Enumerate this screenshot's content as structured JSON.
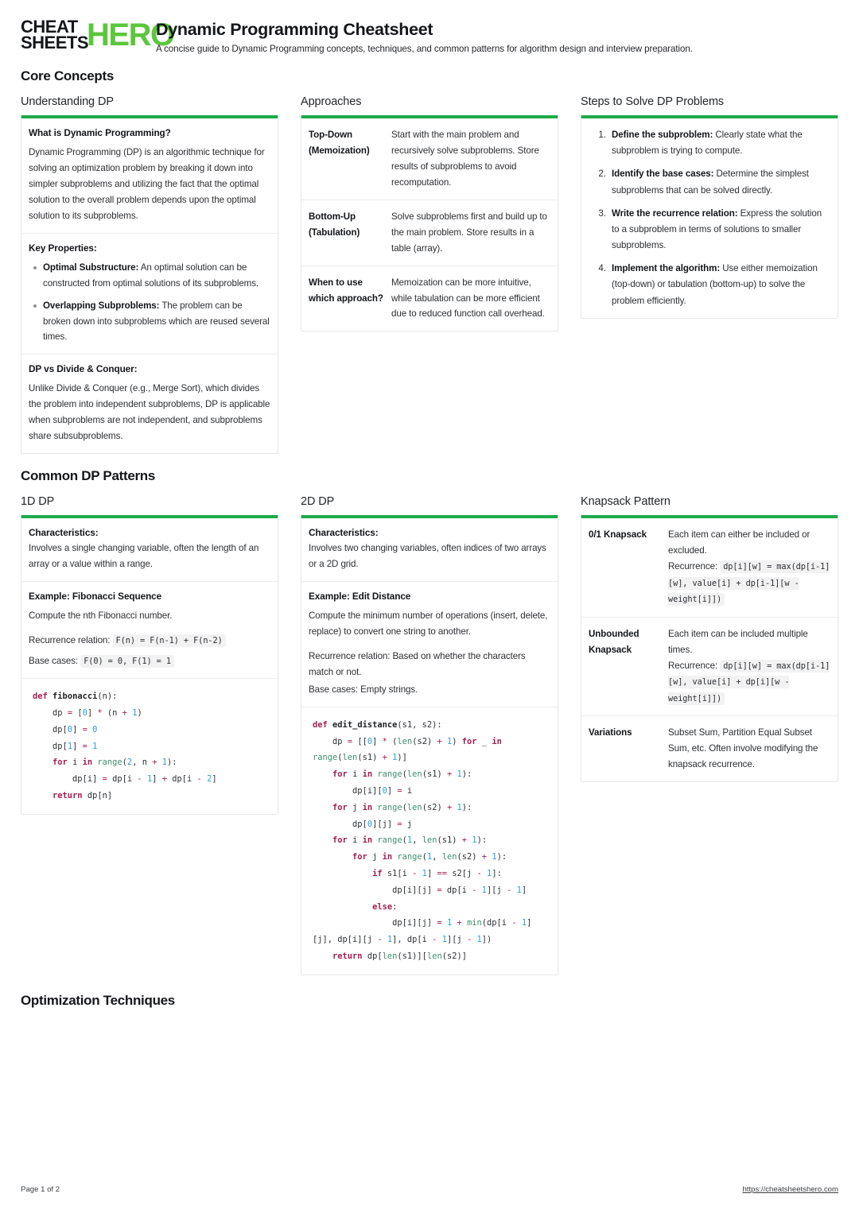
{
  "brand": {
    "line1": "CHEAT",
    "line2": "SHEETS",
    "hero": "HERO",
    "accent": "#5cc63c"
  },
  "header": {
    "title": "Dynamic Programming Cheatsheet",
    "subtitle": "A concise guide to Dynamic Programming concepts, techniques, and common patterns for algorithm design and interview preparation."
  },
  "theme": {
    "card_accent": "#1faa4b",
    "card_border": "#e6e7e9",
    "code_bg": "#f2f2f3"
  },
  "sections": [
    {
      "id": "core-concepts",
      "title": "Core Concepts"
    },
    {
      "id": "common-dp-patterns",
      "title": "Common DP Patterns"
    },
    {
      "id": "optimization-techniques",
      "title": "Optimization Techniques"
    }
  ],
  "core": {
    "understanding": {
      "col_title": "Understanding DP",
      "q_heading": "What is Dynamic Programming?",
      "q_body": "Dynamic Programming (DP) is an algorithmic technique for solving an optimization problem by breaking it down into simpler subproblems and utilizing the fact that the optimal solution to the overall problem depends upon the optimal solution to its subproblems.",
      "key_props_heading": "Key Properties:",
      "key_props": [
        {
          "term": "Optimal Substructure:",
          "desc": " An optimal solution can be constructed from optimal solutions of its subproblems."
        },
        {
          "term": "Overlapping Subproblems:",
          "desc": " The problem can be broken down into subproblems which are reused several times."
        }
      ],
      "dvc_heading": "DP vs Divide & Conquer:",
      "dvc_body": "Unlike Divide & Conquer (e.g., Merge Sort), which divides the problem into independent subproblems, DP is applicable when subproblems are not independent, and subproblems share subsubproblems."
    },
    "approaches": {
      "col_title": "Approaches",
      "rows": [
        {
          "term": "Top-Down (Memoization)",
          "desc": "Start with the main problem and recursively solve subproblems. Store results of subproblems to avoid recomputation."
        },
        {
          "term": "Bottom-Up (Tabulation)",
          "desc": "Solve subproblems first and build up to the main problem. Store results in a table (array)."
        },
        {
          "term": "When to use which approach?",
          "desc": "Memoization can be more intuitive, while tabulation can be more efficient due to reduced function call overhead."
        }
      ]
    },
    "steps": {
      "col_title": "Steps to Solve DP Problems",
      "items": [
        {
          "term": "Define the subproblem:",
          "desc": " Clearly state what the subproblem is trying to compute."
        },
        {
          "term": "Identify the base cases:",
          "desc": " Determine the simplest subproblems that can be solved directly."
        },
        {
          "term": "Write the recurrence relation:",
          "desc": " Express the solution to a subproblem in terms of solutions to smaller subproblems."
        },
        {
          "term": "Implement the algorithm:",
          "desc": " Use either memoization (top-down) or tabulation (bottom-up) to solve the problem efficiently."
        }
      ]
    }
  },
  "patterns": {
    "oned": {
      "col_title": "1D DP",
      "char_heading": "Characteristics:",
      "char_body": "Involves a single changing variable, often the length of an array or a value within a range.",
      "example_heading": "Example: Fibonacci Sequence",
      "example_body": "Compute the nth Fibonacci number.",
      "recurrence_label": "Recurrence relation:",
      "recurrence_code": "F(n) = F(n-1) + F(n-2)",
      "base_label": "Base cases:",
      "base_code": "F(0) = 0, F(1) = 1",
      "code": "def fibonacci(n):\n    dp = [0] * (n + 1)\n    dp[0] = 0\n    dp[1] = 1\n    for i in range(2, n + 1):\n        dp[i] = dp[i - 1] + dp[i - 2]\n    return dp[n]"
    },
    "twod": {
      "col_title": "2D DP",
      "char_heading": "Characteristics:",
      "char_body": "Involves two changing variables, often indices of two arrays or a 2D grid.",
      "example_heading": "Example: Edit Distance",
      "example_body": "Compute the minimum number of operations (insert, delete, replace) to convert one string to another.",
      "recurrence_body": "Recurrence relation: Based on whether the characters match or not.",
      "base_body": "Base cases: Empty strings.",
      "code": "def edit_distance(s1, s2):\n    dp = [[0] * (len(s2) + 1) for _ in range(len(s1) + 1)]\n    for i in range(len(s1) + 1):\n        dp[i][0] = i\n    for j in range(len(s2) + 1):\n        dp[0][j] = j\n    for i in range(1, len(s1) + 1):\n        for j in range(1, len(s2) + 1):\n            if s1[i - 1] == s2[j - 1]:\n                dp[i][j] = dp[i - 1][j - 1]\n            else:\n                dp[i][j] = 1 + min(dp[i - 1][j], dp[i][j - 1], dp[i - 1][j - 1])\n    return dp[len(s1)][len(s2)]"
    },
    "knapsack": {
      "col_title": "Knapsack Pattern",
      "rows": [
        {
          "term": "0/1 Knapsack",
          "desc": "Each item can either be included or excluded.",
          "recurrence_label": "Recurrence:",
          "recurrence_code": "dp[i][w] = max(dp[i-1][w], value[i] + dp[i-1][w - weight[i]])"
        },
        {
          "term": "Unbounded Knapsack",
          "desc": "Each item can be included multiple times.",
          "recurrence_label": "Recurrence:",
          "recurrence_code": "dp[i][w] = max(dp[i-1][w], value[i] + dp[i][w - weight[i]])"
        },
        {
          "term": "Variations",
          "desc": "Subset Sum, Partition Equal Subset Sum, etc. Often involve modifying the knapsack recurrence.",
          "recurrence_label": "",
          "recurrence_code": ""
        }
      ]
    }
  },
  "footer": {
    "page": "Page 1 of 2",
    "url": "https://cheatsheetshero.com"
  }
}
